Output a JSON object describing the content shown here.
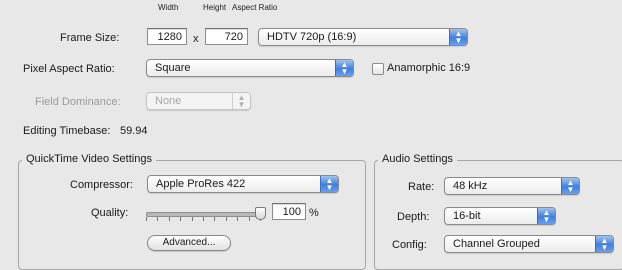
{
  "frame_size": {
    "label": "Frame Size:",
    "width_header": "Width",
    "height_header": "Height",
    "aspect_ratio_header": "Aspect Ratio",
    "width_value": "1280",
    "times": "x",
    "height_value": "720",
    "aspect_ratio_value": "HDTV 720p (16:9)"
  },
  "pixel_aspect_ratio": {
    "label": "Pixel Aspect Ratio:",
    "value": "Square",
    "anamorphic_label": "Anamorphic 16:9",
    "anamorphic_checked": false
  },
  "field_dominance": {
    "label": "Field Dominance:",
    "value": "None"
  },
  "editing_timebase": {
    "label": "Editing Timebase:",
    "value": "59.94"
  },
  "quicktime_video_settings": {
    "title": "QuickTime Video Settings",
    "compressor_label": "Compressor:",
    "compressor_value": "Apple ProRes 422",
    "quality_label": "Quality:",
    "quality_value": "100",
    "quality_unit": "%",
    "quality_fraction": 1.0,
    "advanced_button": "Advanced..."
  },
  "audio_settings": {
    "title": "Audio Settings",
    "rate_label": "Rate:",
    "rate_value": "48 kHz",
    "depth_label": "Depth:",
    "depth_value": "16-bit",
    "config_label": "Config:",
    "config_value": "Channel Grouped"
  },
  "colors": {
    "accent_blue": "#3f7fdd",
    "window_bg": "#e8e8e8"
  }
}
